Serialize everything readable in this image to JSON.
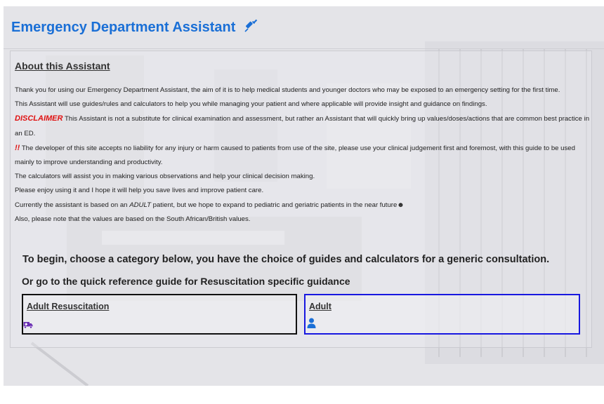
{
  "header": {
    "title": "Emergency Department Assistant",
    "title_icon": "syringe-icon",
    "accent_color": "#1a6fd6"
  },
  "about": {
    "heading": "About this Assistant",
    "para1": "Thank you for using our Emergency Department Assistant, the aim of it is to help medical students and younger doctors who may be exposed to an emergency setting for the first time.",
    "para2": "This Assistant will use guides/rules and calculators to help you while managing your patient and where applicable will provide insight and guidance on findings.",
    "disclaimer_label": "DISCLAIMER",
    "disclaimer_text": " This Assistant is not a substitute for clinical examination and assessment, but rather an Assistant that will quickly bring up values/doses/actions that are common best practice in an ED.",
    "warning_mark": "!!",
    "warning_text": " The developer of this site accepts no liability for any injury or harm caused to patients from use of the site, please use your clinical judgement first and foremost, with this guide to be used mainly to improve understanding and productivity.",
    "para5": "The calculators will assist you in making various observations and help your clinical decision making.",
    "para6": "Please enjoy using it and I hope it will help you save lives and improve patient care.",
    "para7_before": "Currently the assistant is based on an ",
    "para7_em": "ADULT",
    "para7_after": " patient, but we hope to expand to pediatric and geriatric patients in the near future",
    "para7_emoji": "☻",
    "para8": "Also, please note that the values are based on the South African/British values."
  },
  "instructions": {
    "line1": "To begin, choose a category below, you have the choice of guides and calculators for a generic consultation.",
    "line2": "Or go to the quick reference guide for Resuscitation specific guidance"
  },
  "cards": [
    {
      "label": "Adult Resuscitation",
      "icon": "ambulance-icon",
      "icon_color": "#6b2fb3",
      "border_color": "#111111"
    },
    {
      "label": "Adult",
      "icon": "person-icon",
      "icon_color": "#1a6fd6",
      "border_color": "#1818e0"
    }
  ]
}
